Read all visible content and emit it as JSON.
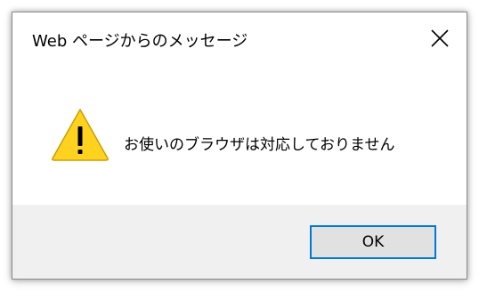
{
  "dialog": {
    "title": "Web ページからのメッセージ",
    "message": "お使いのブラウザは対応しておりません",
    "icon": "warning-icon",
    "close_icon": "close-icon",
    "ok_label": "OK",
    "colors": {
      "accent": "#0078d7",
      "warning_fill": "#ffd21f",
      "footer_bg": "#f0f0f0"
    }
  }
}
